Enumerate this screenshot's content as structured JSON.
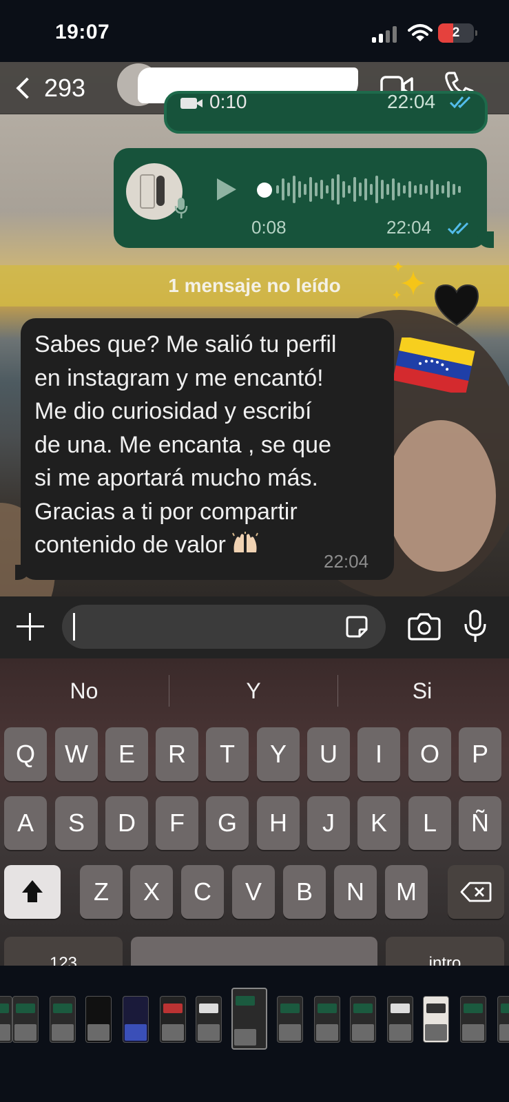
{
  "status_bar": {
    "time": "19:07",
    "battery": "2",
    "colors": {
      "battery_low": "#e5413d"
    }
  },
  "header": {
    "back_count": "293",
    "contact_name": "",
    "icons": [
      "chevron-left-icon",
      "video-camera-icon",
      "phone-icon"
    ]
  },
  "messages": {
    "video": {
      "duration": "0:10",
      "time": "22:04",
      "status": "read"
    },
    "voice": {
      "duration": "0:08",
      "time": "22:04",
      "status": "read"
    },
    "unread_banner": "1 mensaje no leído",
    "incoming": {
      "text": "Sabes que? Me salió tu perfil\nen instagram y me encantó!\nMe dio curiosidad y escribí\nde una. Me encanta , se que\nsi me aportará mucho más.\nGracias a ti por compartir\ncontenido de valor",
      "emoji": "raising-hands",
      "time": "22:04"
    }
  },
  "input_bar": {
    "value": "",
    "icons": [
      "plus-icon",
      "sticker-icon",
      "camera-icon",
      "microphone-icon"
    ]
  },
  "keyboard": {
    "suggestions": [
      "No",
      "Y",
      "Si"
    ],
    "rows": [
      [
        "Q",
        "W",
        "E",
        "R",
        "T",
        "Y",
        "U",
        "I",
        "O",
        "P"
      ],
      [
        "A",
        "S",
        "D",
        "F",
        "G",
        "H",
        "J",
        "K",
        "L",
        "Ñ"
      ],
      [
        "Z",
        "X",
        "C",
        "V",
        "B",
        "N",
        "M"
      ]
    ],
    "bottom_row": {
      "numbers": "123",
      "return": "intro"
    }
  },
  "colors": {
    "outgoing_bubble": "#17533b",
    "incoming_bubble": "#1f1f1f",
    "unread_banner": "#d2b946",
    "read_ticks": "#53bdeb"
  }
}
